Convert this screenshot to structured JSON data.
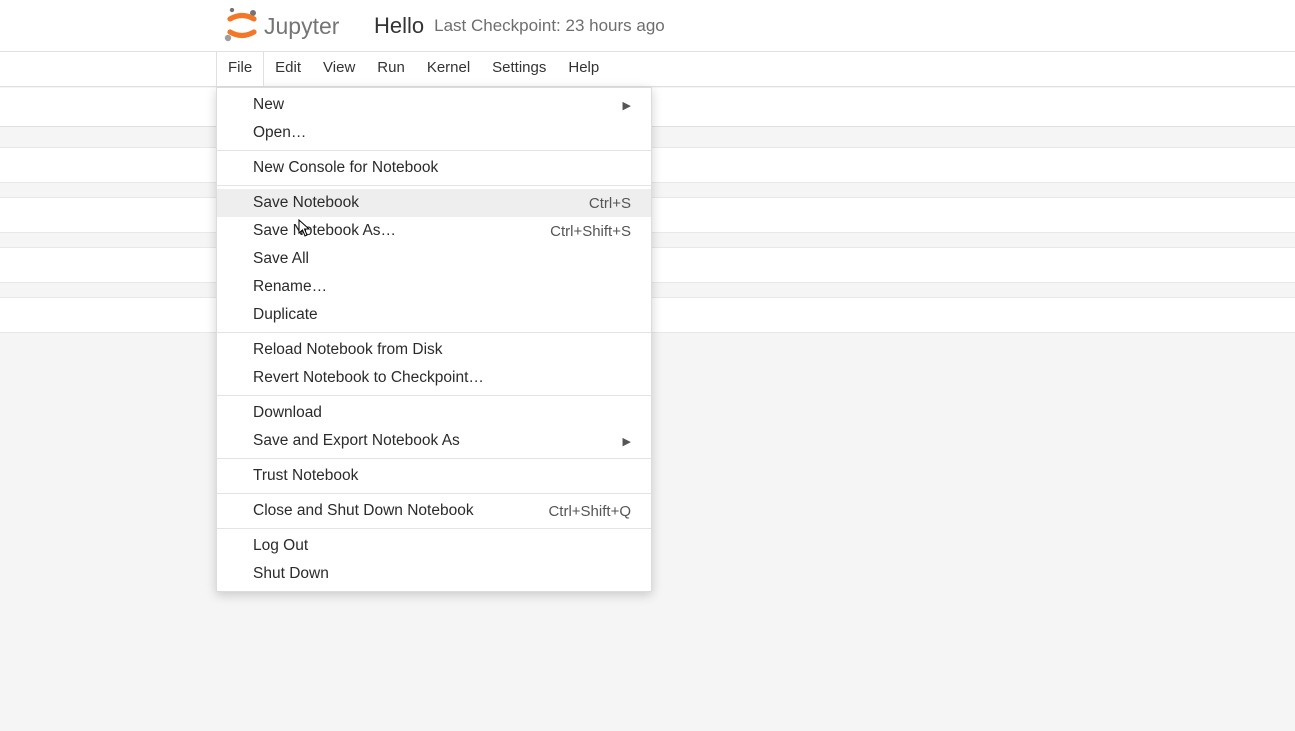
{
  "header": {
    "logo_text": "Jupyter",
    "notebook_title": "Hello",
    "checkpoint": "Last Checkpoint: 23 hours ago"
  },
  "menubar": {
    "file": "File",
    "edit": "Edit",
    "view": "View",
    "run": "Run",
    "kernel": "Kernel",
    "settings": "Settings",
    "help": "Help"
  },
  "file_menu": {
    "new": "New",
    "open": "Open…",
    "new_console": "New Console for Notebook",
    "save_notebook": "Save Notebook",
    "save_notebook_shortcut": "Ctrl+S",
    "save_notebook_as": "Save Notebook As…",
    "save_notebook_as_shortcut": "Ctrl+Shift+S",
    "save_all": "Save All",
    "rename": "Rename…",
    "duplicate": "Duplicate",
    "reload": "Reload Notebook from Disk",
    "revert": "Revert Notebook to Checkpoint…",
    "download": "Download",
    "export": "Save and Export Notebook As",
    "trust": "Trust Notebook",
    "close_shutdown": "Close and Shut Down Notebook",
    "close_shutdown_shortcut": "Ctrl+Shift+Q",
    "logout": "Log Out",
    "shutdown": "Shut Down"
  }
}
